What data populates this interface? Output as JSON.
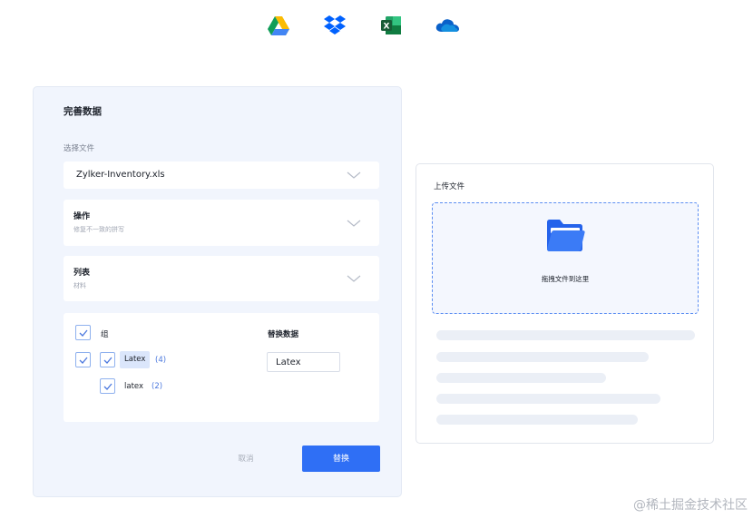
{
  "integrations": [
    {
      "icon": "google-drive-icon"
    },
    {
      "icon": "dropbox-icon"
    },
    {
      "icon": "excel-icon"
    },
    {
      "icon": "onedrive-icon"
    }
  ],
  "form": {
    "title": "完善数据",
    "file_label": "选择文件",
    "file_value": "Zylker-Inventory.xls",
    "operation": {
      "title": "操作",
      "subtitle": "修复不一致的拼写"
    },
    "list": {
      "title": "列表",
      "subtitle": "材料"
    },
    "group_label": "组",
    "items": [
      {
        "label": "Latex",
        "count": "(4)"
      },
      {
        "label": "latex",
        "count": "(2)"
      }
    ],
    "replace_label": "替换数据",
    "replace_value": "Latex",
    "cancel_label": "取消",
    "submit_label": "替换"
  },
  "upload": {
    "title": "上传文件",
    "drop_text": "拖拽文件到这里"
  },
  "watermark": "@稀土掘金技术社区",
  "colors": {
    "accent": "#2f6ff5",
    "panel_bg": "#f1f5fd",
    "dashed_border": "#5b8df2"
  }
}
